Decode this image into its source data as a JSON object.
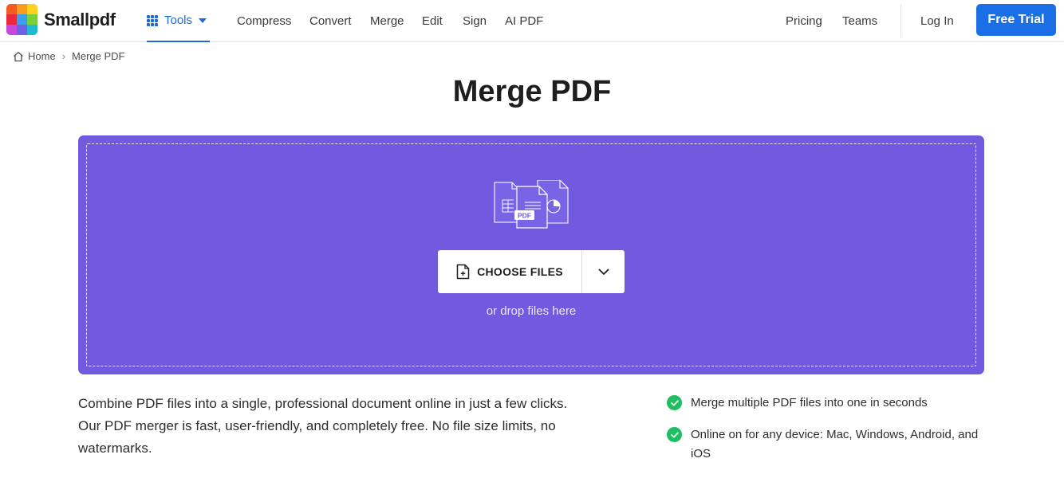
{
  "header": {
    "logo_text": "Smallpdf",
    "tools_label": "Tools",
    "nav": [
      "Compress",
      "Convert",
      "Merge",
      "Edit",
      "Sign",
      "AI PDF"
    ],
    "pricing": "Pricing",
    "teams": "Teams",
    "login": "Log In",
    "free_trial": "Free Trial",
    "accent_color": "#1a6ee6"
  },
  "breadcrumb": {
    "home": "Home",
    "separator": "›",
    "current": "Merge PDF"
  },
  "page_title": "Merge PDF",
  "dropzone": {
    "background_color": "#715ae0",
    "illustration_badge": "PDF",
    "choose_files": "CHOOSE FILES",
    "drop_hint": "or drop files here"
  },
  "description": "Combine PDF files into a single, professional document online in just a few clicks. Our PDF merger is fast, user-friendly, and completely free. No file size limits, no watermarks.",
  "features": [
    "Merge multiple PDF files into one in seconds",
    "Online on for any device: Mac, Windows, Android, and iOS"
  ],
  "icons": {
    "logo": "smallpdf-logo-icon",
    "tools": "grid-icon",
    "home": "home-icon",
    "choose": "file-add-icon",
    "dropdown": "chevron-down-icon",
    "check": "check-circle-icon"
  },
  "feature_check_color": "#1ebd62"
}
